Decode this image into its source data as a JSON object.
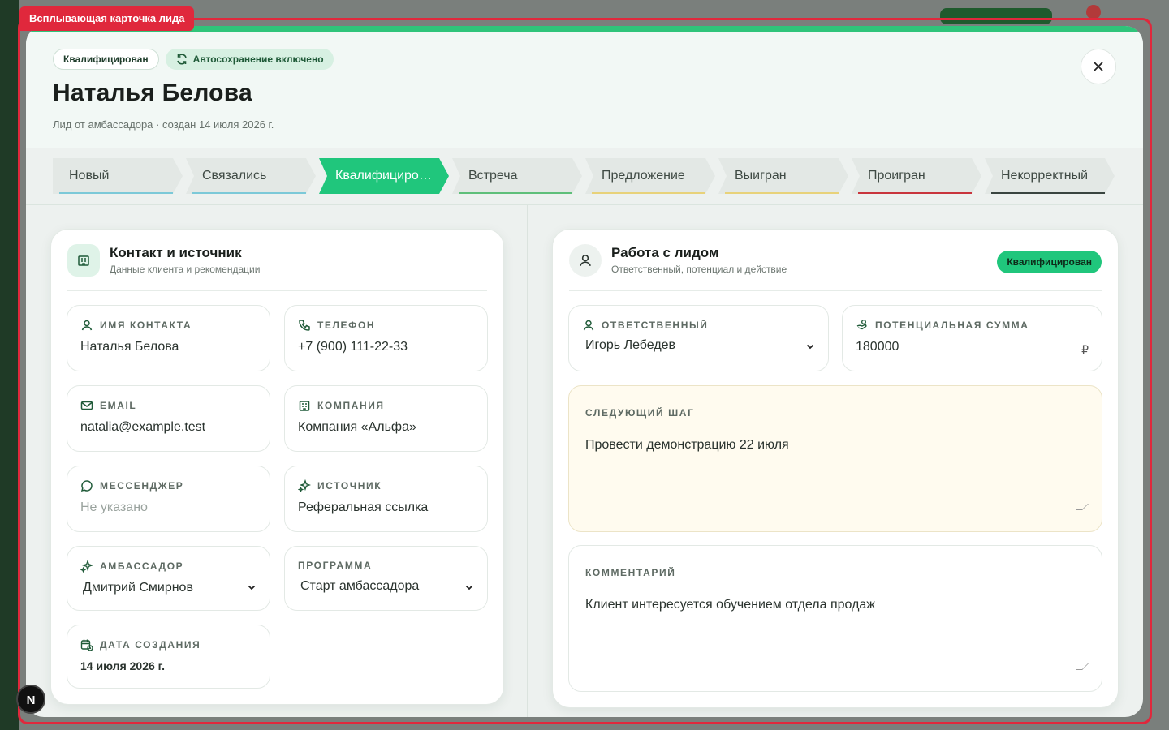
{
  "overlay": {
    "tag_label": "Всплывающая карточка лида"
  },
  "header": {
    "status_chip": "Квалифицирован",
    "autosave_chip": "Автосохранение включено",
    "title": "Наталья Белова",
    "subtitle": "Лид от амбассадора · создан 14 июля 2026 г."
  },
  "stages": [
    {
      "label": "Новый",
      "accent": "#7cc9d8"
    },
    {
      "label": "Связались",
      "accent": "#7cc9d8"
    },
    {
      "label": "Квалифицирован",
      "accent": "#20c67c"
    },
    {
      "label": "Встреча",
      "accent": "#5fbf7a"
    },
    {
      "label": "Предложение",
      "accent": "#e8d27a"
    },
    {
      "label": "Выигран",
      "accent": "#e8d27a"
    },
    {
      "label": "Проигран",
      "accent": "#c9353d"
    },
    {
      "label": "Некорректный",
      "accent": "#3a4540"
    }
  ],
  "active_stage": "Квалифицирован",
  "contact_card": {
    "title": "Контакт и источник",
    "subtitle": "Данные клиента и рекомендации",
    "fields": {
      "name": {
        "label": "Имя контакта",
        "value": "Наталья Белова"
      },
      "phone": {
        "label": "Телефон",
        "value": "+7 (900) 111-22-33"
      },
      "email": {
        "label": "Email",
        "value": "natalia@example.test"
      },
      "company": {
        "label": "Компания",
        "value": "Компания «Альфа»"
      },
      "messenger": {
        "label": "Мессенджер",
        "value": "Не указано"
      },
      "source": {
        "label": "Источник",
        "value": "Реферальная ссылка"
      },
      "ambassador": {
        "label": "Амбассадор",
        "value": "Дмитрий Смирнов"
      },
      "program": {
        "label": "Программа",
        "value": "Старт амбассадора"
      },
      "created": {
        "label": "Дата создания",
        "value": "14 июля 2026 г."
      }
    }
  },
  "work_card": {
    "title": "Работа с лидом",
    "subtitle": "Ответственный, потенциал и действие",
    "badge": "Квалифицирован",
    "owner": {
      "label": "Ответственный",
      "value": "Игорь Лебедев"
    },
    "amount": {
      "label": "Потенциальная сумма",
      "value": "180000",
      "currency": "₽"
    },
    "next_step": {
      "label": "Следующий шаг",
      "value": "Провести демонстрацию 22 июля"
    },
    "comment": {
      "label": "Комментарий",
      "value": "Клиент интересуется обучением отдела продаж"
    }
  },
  "dev_badge": "N",
  "colors": {
    "accent": "#20c67c",
    "debug": "#e0283c"
  }
}
